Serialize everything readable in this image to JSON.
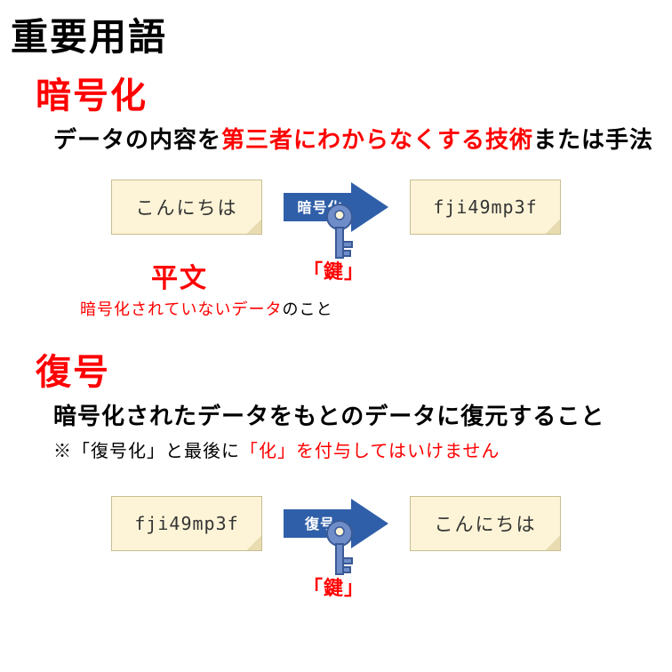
{
  "title": "重要用語",
  "encrypt": {
    "heading": "暗号化",
    "definition_pre": "データの内容を",
    "definition_red": "第三者にわからなくする技術",
    "definition_post": "または手法",
    "input_text": "こんにちは",
    "arrow_label": "暗号化",
    "output_text": "fji49mp3f",
    "key_label": "「鍵」",
    "plaintext_label": "平文",
    "plaintext_sub_red": "暗号化されていないデータ",
    "plaintext_sub_post": "のこと"
  },
  "decrypt": {
    "heading": "復号",
    "definition": "暗号化されたデータをもとのデータに復元すること",
    "caution_pre": "※「復号化」と最後に",
    "caution_red": "「化」を付与してはいけません",
    "input_text": "fji49mp3f",
    "arrow_label": "復号",
    "output_text": "こんにちは",
    "key_label": "「鍵」"
  }
}
